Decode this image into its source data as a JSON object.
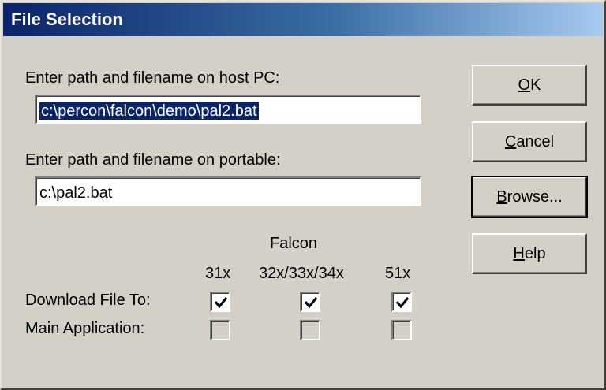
{
  "title": "File Selection",
  "host_path": {
    "label": "Enter path and filename on host PC:",
    "value": "c:\\percon\\falcon\\demo\\pal2.bat"
  },
  "portable_path": {
    "label": "Enter path and filename on portable:",
    "value": "c:\\pal2.bat"
  },
  "buttons": {
    "ok": {
      "accel": "O",
      "rest": "K"
    },
    "cancel": {
      "accel": "C",
      "rest": "ancel"
    },
    "browse": {
      "accel": "B",
      "rest": "rowse..."
    },
    "help": {
      "accel": "H",
      "rest": "elp"
    }
  },
  "falcon": {
    "group_label": "Falcon",
    "columns": [
      "31x",
      "32x/33x/34x",
      "51x"
    ],
    "rows": [
      {
        "label": "Download File To:",
        "checked": [
          true,
          true,
          true
        ],
        "enabled": true
      },
      {
        "label": "Main Application:",
        "checked": [
          false,
          false,
          false
        ],
        "enabled": false
      }
    ]
  },
  "icons": {
    "checkmark": "checkmark-icon"
  }
}
